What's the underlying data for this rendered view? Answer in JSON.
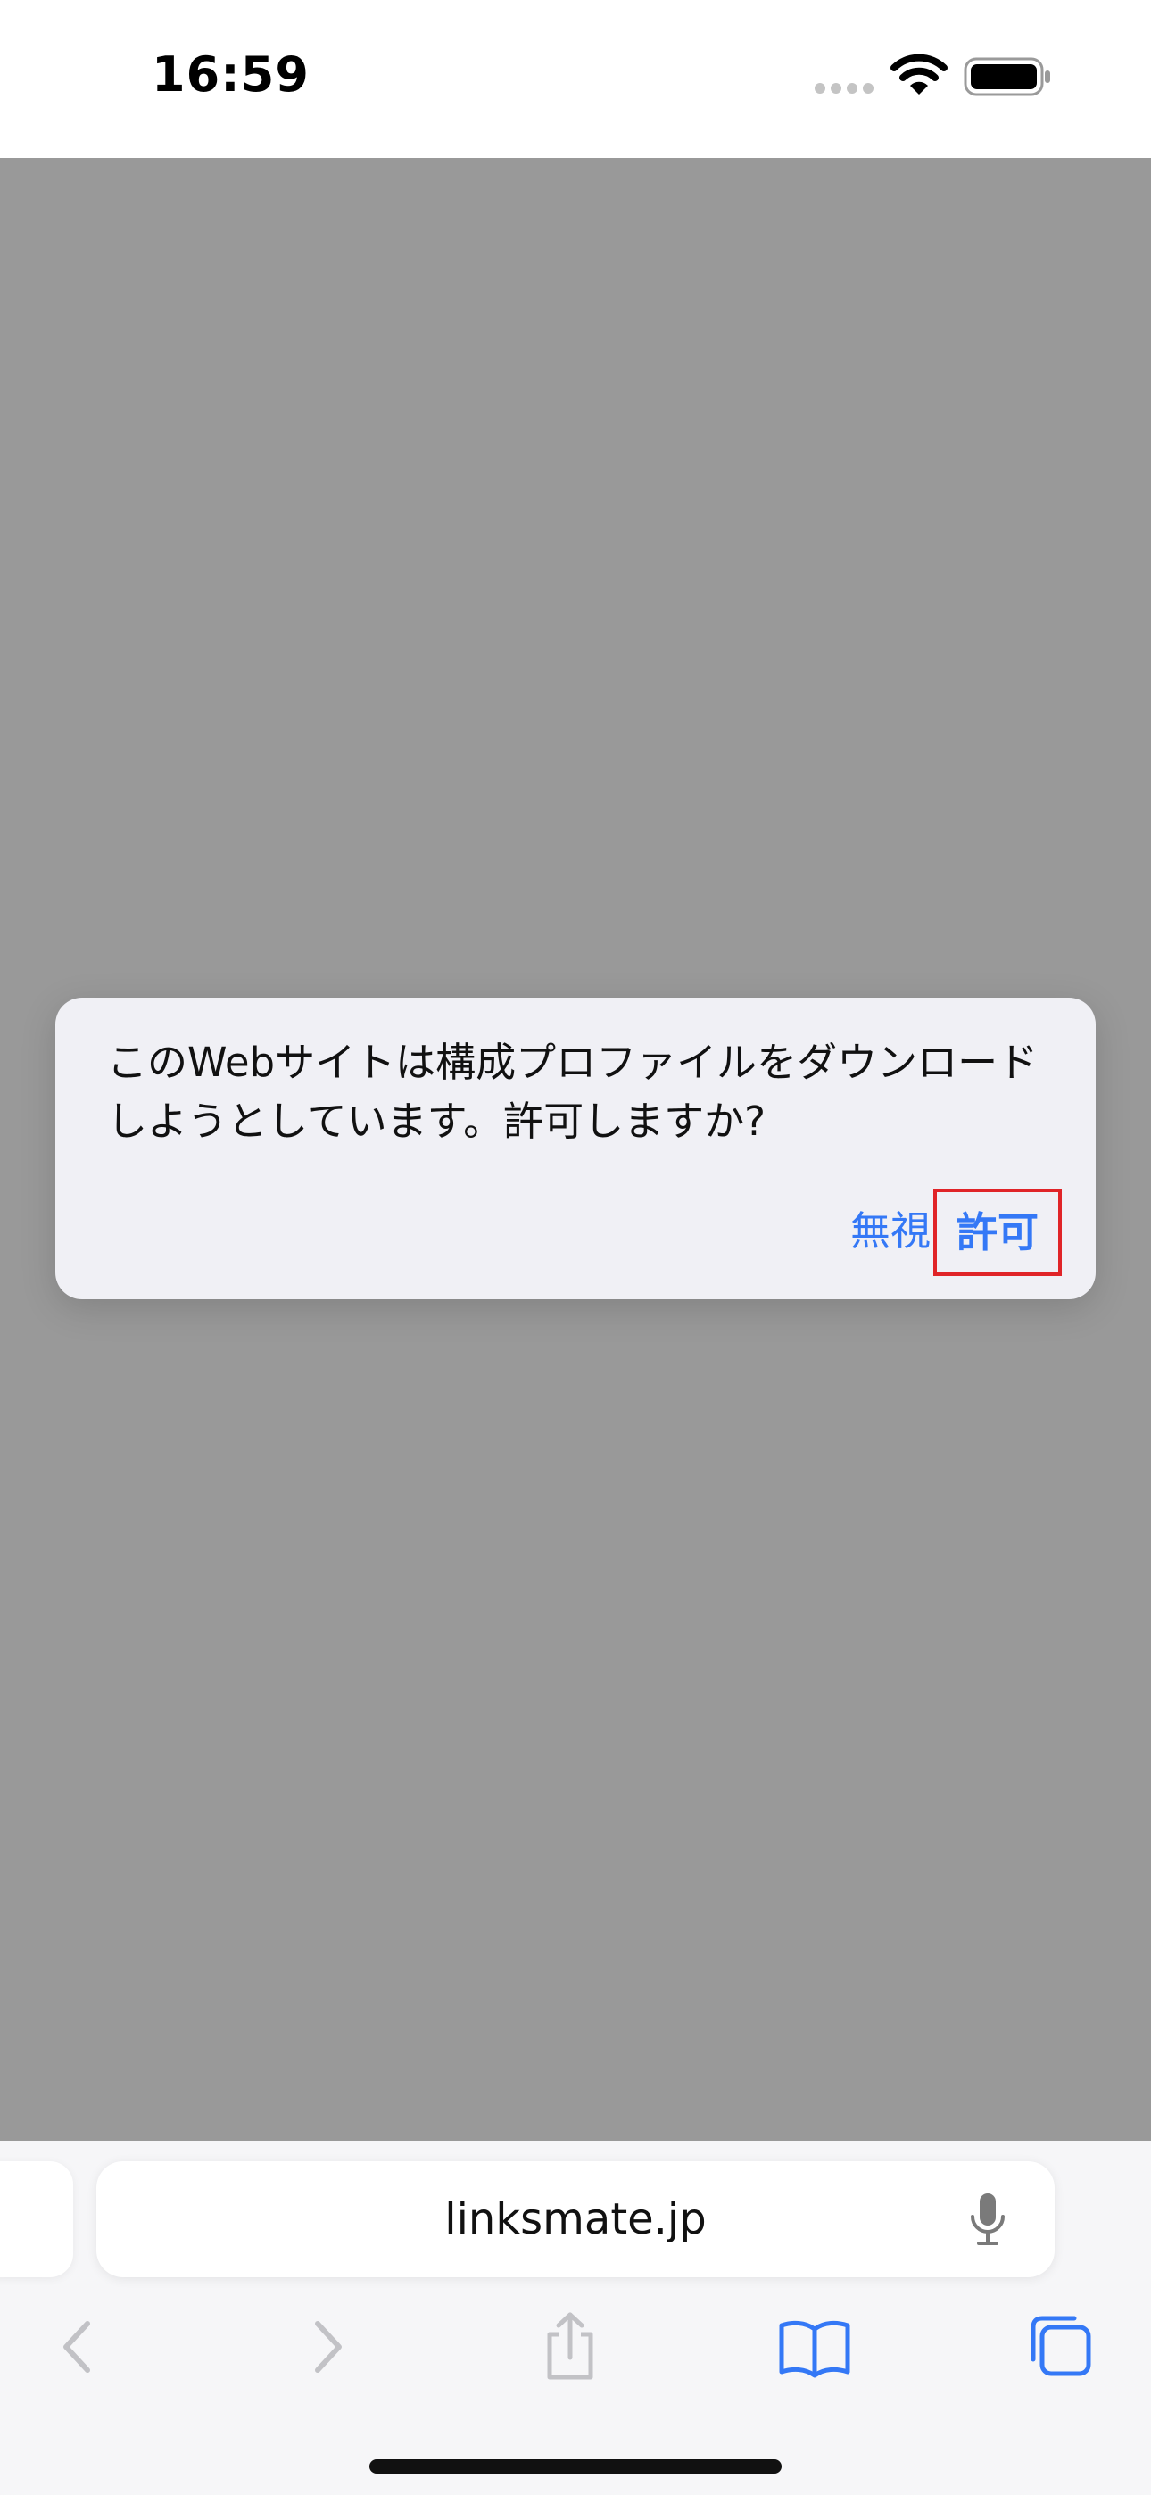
{
  "status_bar": {
    "time": "16:59",
    "icons": [
      "cellular-signal-icon",
      "wifi-icon",
      "battery-icon"
    ]
  },
  "alert": {
    "message": "このWebサイトは構成プロファイルをダウンロードしようとしています。許可しますか?",
    "ignore_label": "無視",
    "allow_label": "許可",
    "accent_color": "#3478f6",
    "highlight_color": "#e02428"
  },
  "address_bar": {
    "url": "linksmate.jp",
    "icon": "microphone-icon"
  },
  "toolbar": {
    "icons": [
      "back-icon",
      "forward-icon",
      "share-icon",
      "bookmarks-icon",
      "tabs-icon"
    ]
  }
}
